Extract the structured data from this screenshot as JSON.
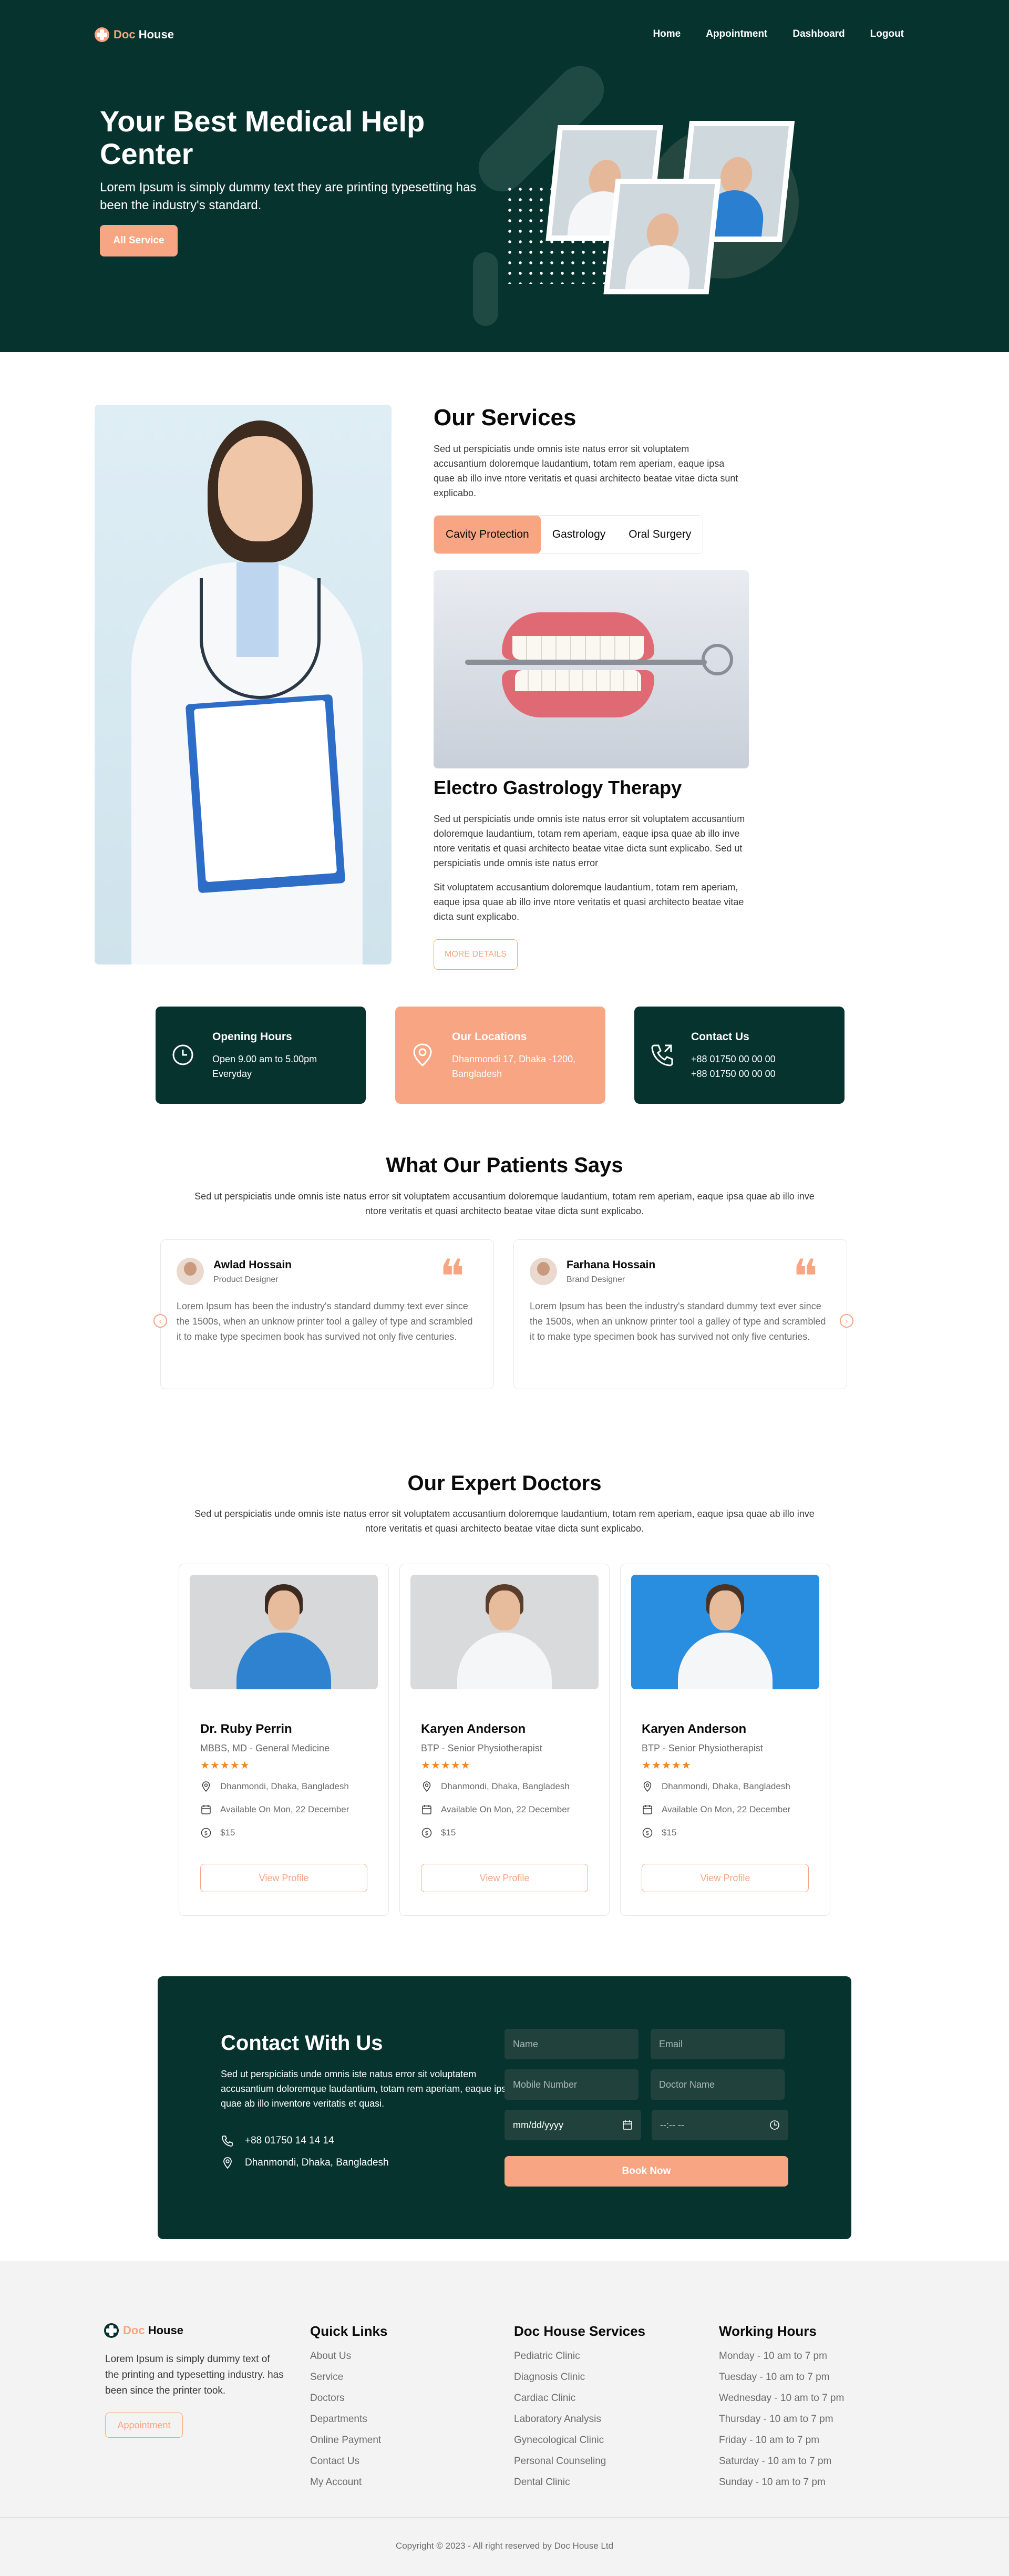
{
  "nav": {
    "logo_text": "Doc",
    "logo_accent": "House",
    "links": [
      "Home",
      "Appointment",
      "Dashboard",
      "Logout"
    ]
  },
  "hero": {
    "title": "Your Best Medical Help Center",
    "subtitle": "Lorem Ipsum is simply dummy text they are printing typesetting has been the industry's standard.",
    "button": "All Service"
  },
  "services": {
    "title": "Our Services",
    "description": "Sed ut perspiciatis unde omnis iste natus error sit voluptatem accusantium doloremque laudantium, totam rem aperiam, eaque ipsa quae ab illo inve ntore veritatis et quasi architecto beatae vitae dicta sunt explicabo.",
    "tabs": [
      "Cavity Protection",
      "Gastrology",
      "Oral Surgery"
    ],
    "active_tab": "Cavity Protection",
    "subtitle": "Electro Gastrology Therapy",
    "para1": "Sed ut perspiciatis unde omnis iste natus error sit voluptatem accusantium doloremque laudantium, totam rem aperiam, eaque ipsa quae ab illo inve ntore veritatis et quasi architecto beatae vitae dicta sunt explicabo. Sed ut perspiciatis unde omnis iste natus error",
    "para2": "Sit voluptatem accusantium doloremque laudantium, totam rem aperiam, eaque ipsa quae ab illo inve ntore veritatis et quasi architecto beatae vitae dicta sunt explicabo.",
    "more_button": "MORE DETAILS"
  },
  "info_cards": [
    {
      "title": "Opening Hours",
      "text": "Open 9.00 am to 5.00pm Everyday",
      "icon": "clock-icon"
    },
    {
      "title": "Our Locations",
      "text": "Dhanmondi 17, Dhaka -1200, Bangladesh",
      "icon": "location-pin-icon"
    },
    {
      "title": "Contact Us",
      "text1": "+88 01750 00 00 00",
      "text2": "+88 01750 00 00 00",
      "icon": "phone-icon"
    }
  ],
  "testimonials": {
    "title": "What Our Patients Says",
    "description": "Sed ut perspiciatis unde omnis iste natus error sit voluptatem accusantium doloremque laudantium, totam rem aperiam, eaque ipsa quae ab illo inve ntore veritatis et quasi architecto beatae vitae dicta sunt explicabo.",
    "items": [
      {
        "name": "Awlad Hossain",
        "role": "Product Designer",
        "text": "Lorem Ipsum has been the industry's standard dummy text ever since the 1500s, when an unknow printer tool a galley of type and scrambled it to make type specimen book has survived not only five centuries."
      },
      {
        "name": "Farhana Hossain",
        "role": "Brand Designer",
        "text": "Lorem Ipsum has been the industry's standard dummy text ever since the 1500s, when an unknow printer tool a galley of type and scrambled it to make type specimen book has survived not only five centuries."
      }
    ]
  },
  "doctors": {
    "title": "Our Expert Doctors",
    "description": "Sed ut perspiciatis unde omnis iste natus error sit voluptatem accusantium doloremque laudantium, totam rem aperiam, eaque ipsa quae ab illo inve ntore veritatis et quasi architecto beatae vitae dicta sunt explicabo.",
    "items": [
      {
        "name": "Dr. Ruby Perrin",
        "title": "MBBS, MD - General Medicine",
        "rating": 5,
        "location": "Dhanmondi, Dhaka, Bangladesh",
        "availability": "Available On Mon, 22 December",
        "fee": "$15",
        "button": "View Profile"
      },
      {
        "name": "Karyen Anderson",
        "title": "BTP - Senior Physiotherapist",
        "rating": 5,
        "location": "Dhanmondi, Dhaka, Bangladesh",
        "availability": "Available On Mon, 22 December",
        "fee": "$15",
        "button": "View Profile"
      },
      {
        "name": "Karyen Anderson",
        "title": "BTP - Senior Physiotherapist",
        "rating": 5,
        "location": "Dhanmondi, Dhaka, Bangladesh",
        "availability": "Available On Mon, 22 December",
        "fee": "$15",
        "button": "View Profile"
      }
    ],
    "stars": "★★★★★"
  },
  "contact": {
    "title": "Contact With Us",
    "description": "Sed ut perspiciatis unde omnis iste natus error sit voluptatem accusantium doloremque laudantium, totam rem aperiam, eaque ipsa quae ab illo inventore veritatis et quasi.",
    "phone": "+88 01750 14 14 14",
    "address": "Dhanmondi, Dhaka, Bangladesh",
    "placeholders": {
      "name": "Name",
      "email": "Email",
      "mobile": "Mobile Number",
      "doctor": "Doctor Name"
    },
    "date_value": "mm/dd/yyyy",
    "time_value": "--:-- --",
    "submit": "Book Now"
  },
  "footer": {
    "logo_text": "Doc",
    "logo_accent": "House",
    "description": "Lorem Ipsum is simply dummy text of the printing and typesetting industry. has been since the printer took.",
    "button": "Appointment",
    "quick_links_title": "Quick Links",
    "quick_links": [
      "About Us",
      "Service",
      "Doctors",
      "Departments",
      "Online Payment",
      "Contact Us",
      "My Account"
    ],
    "services_title": "Doc House Services",
    "services": [
      "Pediatric Clinic",
      "Diagnosis Clinic",
      "Cardiac Clinic",
      "Laboratory Analysis",
      "Gynecological Clinic",
      "Personal Counseling",
      "Dental Clinic"
    ],
    "hours_title": "Working Hours",
    "hours": [
      "Monday - 10 am to 7 pm",
      "Tuesday - 10 am to 7 pm",
      "Wednesday - 10 am to 7 pm",
      "Thursday - 10 am to 7 pm",
      "Friday - 10 am to 7 pm",
      "Saturday - 10 am to 7 pm",
      "Sunday - 10 am to 7 pm"
    ],
    "copyright": "Copyright © 2023 - All right reserved by Doc House Ltd"
  },
  "colors": {
    "primary_dark": "#07332f",
    "accent": "#f7a582",
    "star": "#f2871f"
  }
}
